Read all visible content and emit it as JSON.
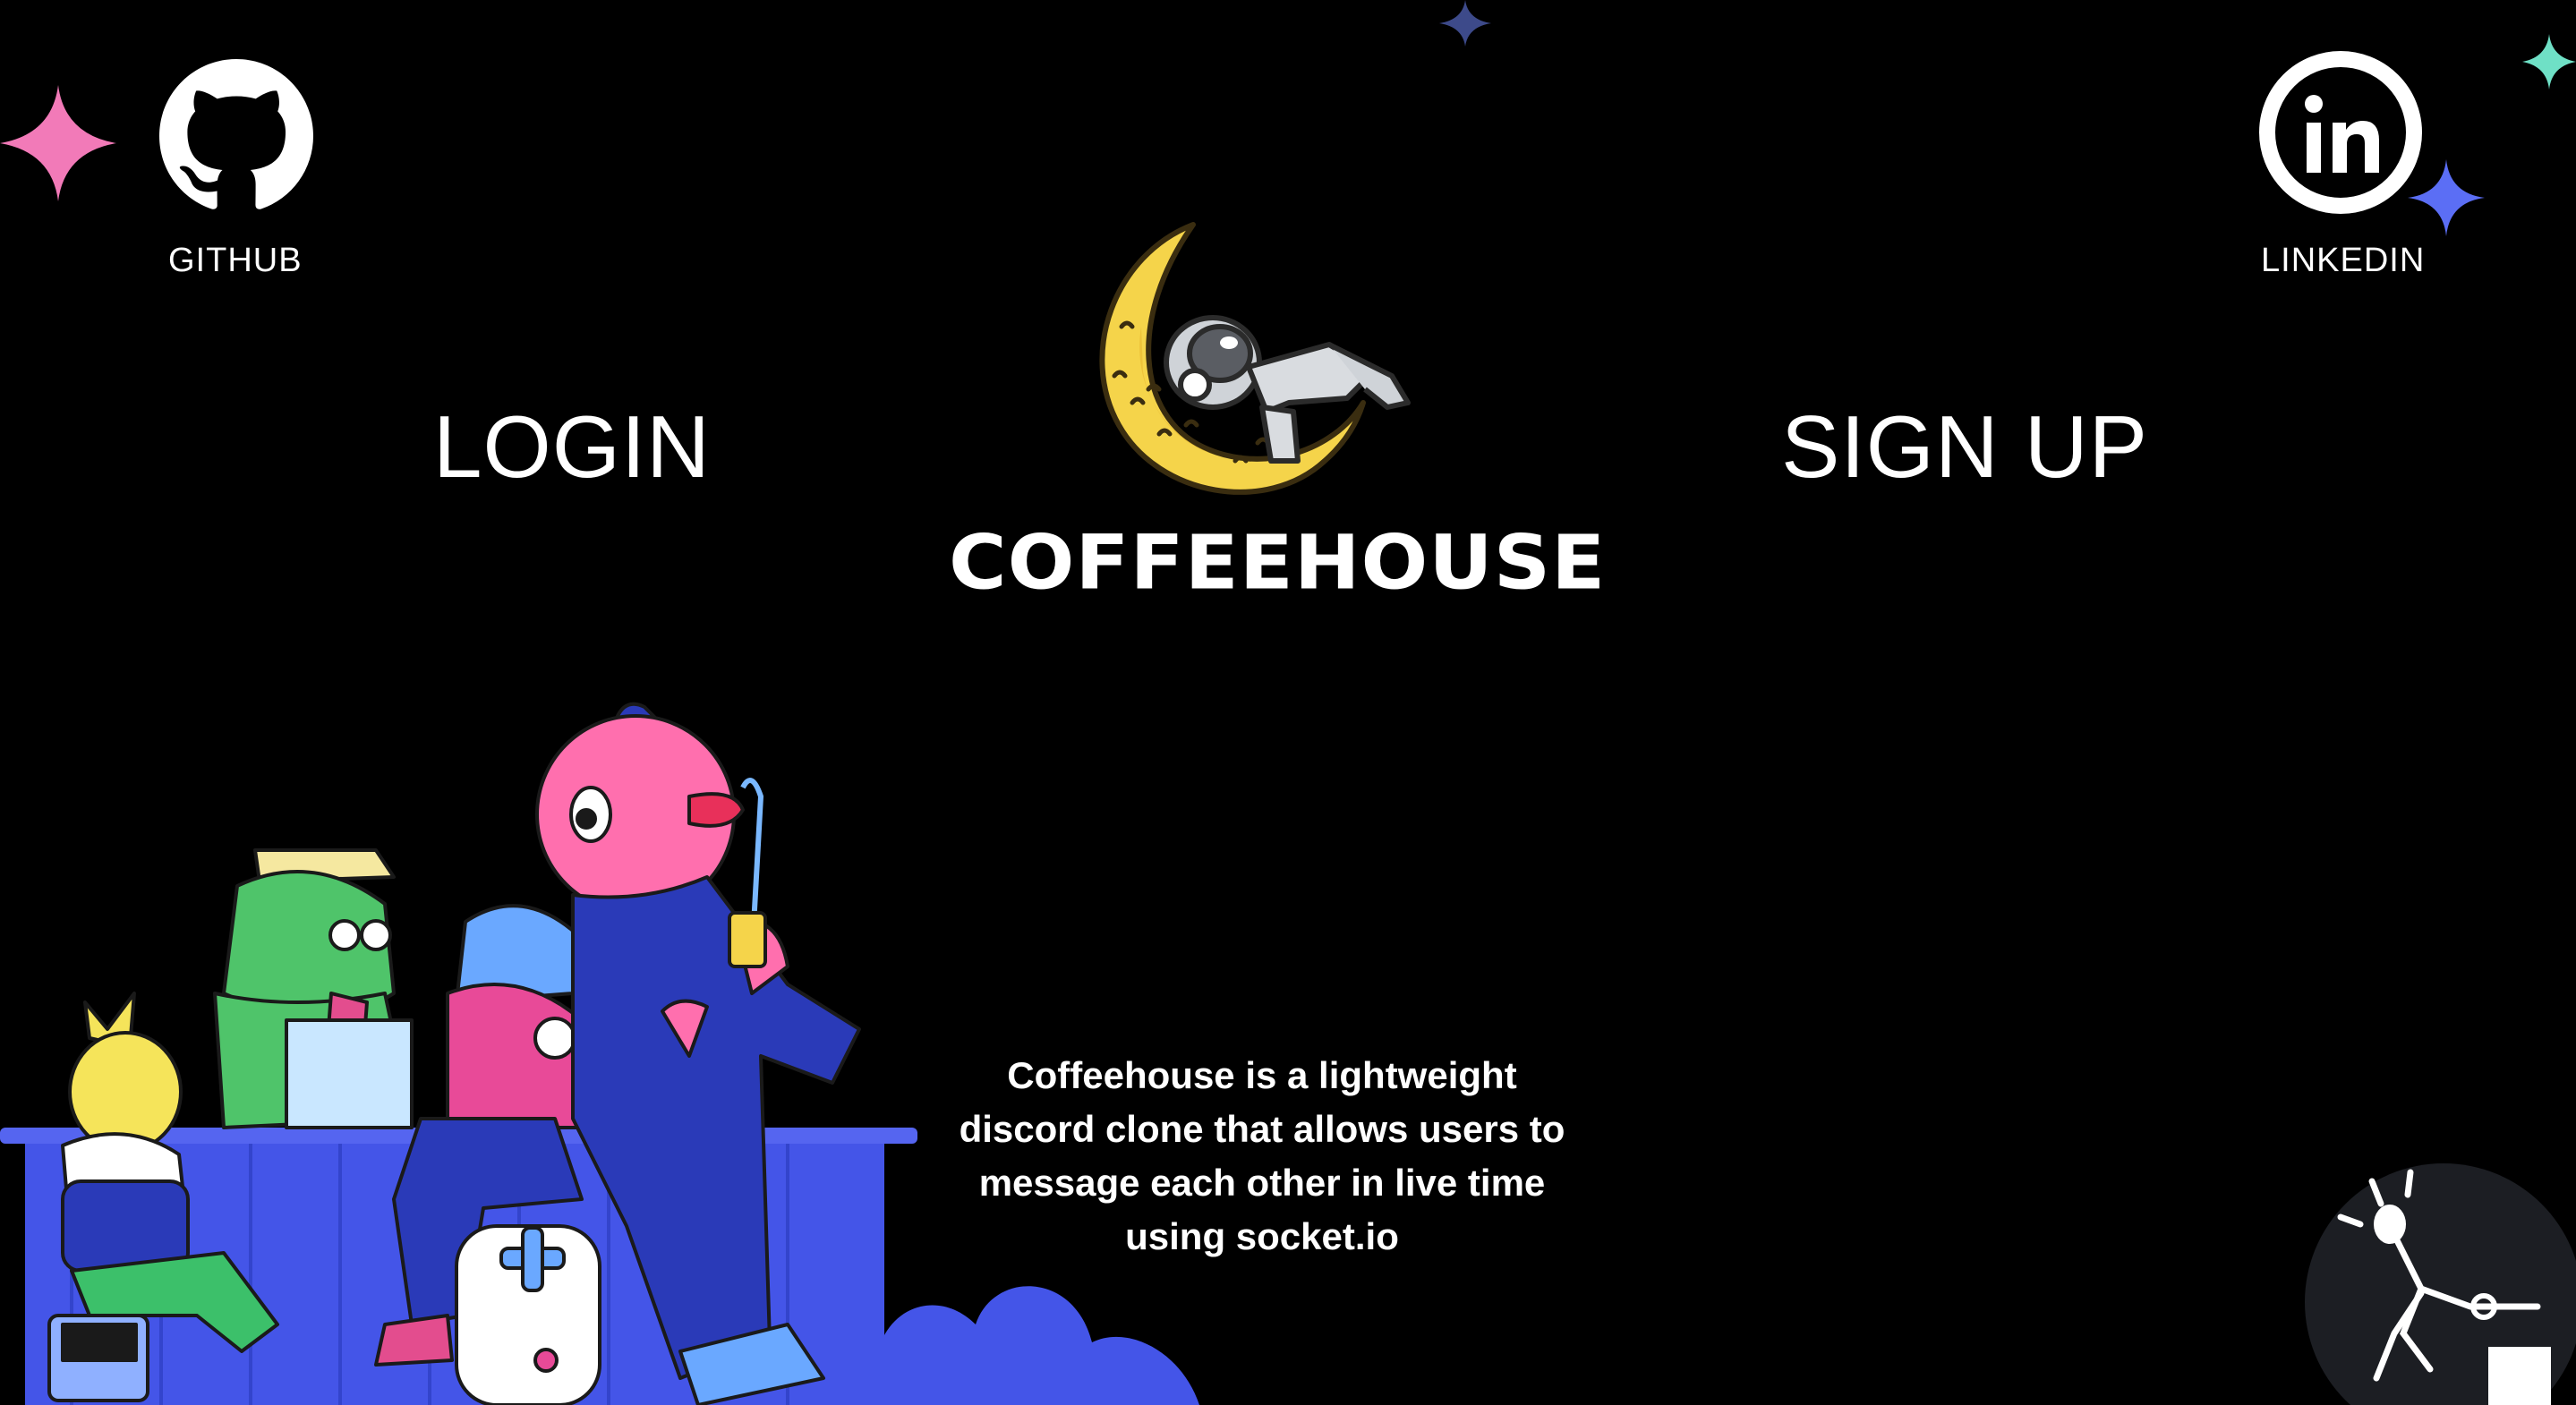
{
  "social": {
    "github_label": "GITHUB",
    "linkedin_label": "LINKEDIN",
    "github_icon": "github-icon",
    "linkedin_icon": "linkedin-icon"
  },
  "nav": {
    "login_label": "LOGIN",
    "signup_label": "SIGN UP"
  },
  "brand": {
    "name": "COFFEEHOUSE",
    "logo_icon": "moon-astronaut-logo"
  },
  "description": "Coffeehouse is a lightweight discord clone that allows users to message each other in live time using socket.io",
  "colors": {
    "background": "#000000",
    "text": "#ffffff",
    "moon": "#f5d44a",
    "pink_sparkle": "#f27ab8",
    "blue_sparkle": "#5b6ef5",
    "teal_sparkle": "#6fe0c6",
    "navy_sparkle": "#3d4a8a",
    "counter_blue": "#4455e8"
  }
}
